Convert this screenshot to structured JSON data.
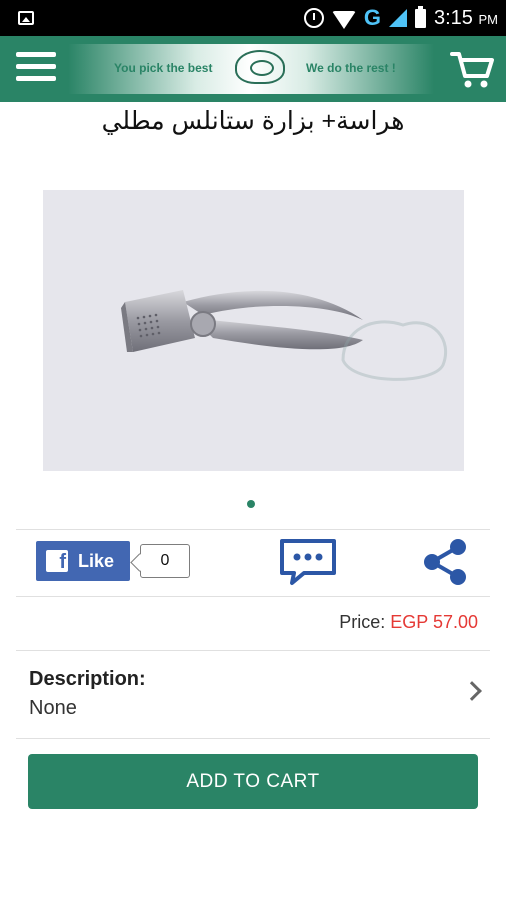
{
  "status_bar": {
    "time": "3:15",
    "ampm": "PM",
    "network": "G"
  },
  "app_bar": {
    "tagline_left": "You pick the best",
    "tagline_right": "We do the rest !",
    "icons": [
      "menu-icon",
      "cart-icon"
    ]
  },
  "product": {
    "title": "هراسة+ بزارة ستانلس مطلي",
    "price_label": "Price: ",
    "price_value": "EGP 57.00"
  },
  "social": {
    "like_label": "Like",
    "like_count": "0",
    "icons": [
      "facebook-icon",
      "comment-icon",
      "share-icon"
    ]
  },
  "description": {
    "label": "Description:",
    "value": "None"
  },
  "actions": {
    "add_to_cart": "ADD TO CART"
  },
  "colors": {
    "primary": "#2a8466",
    "price": "#e53935",
    "facebook": "#4267b2",
    "icon_blue": "#2c57a6"
  }
}
